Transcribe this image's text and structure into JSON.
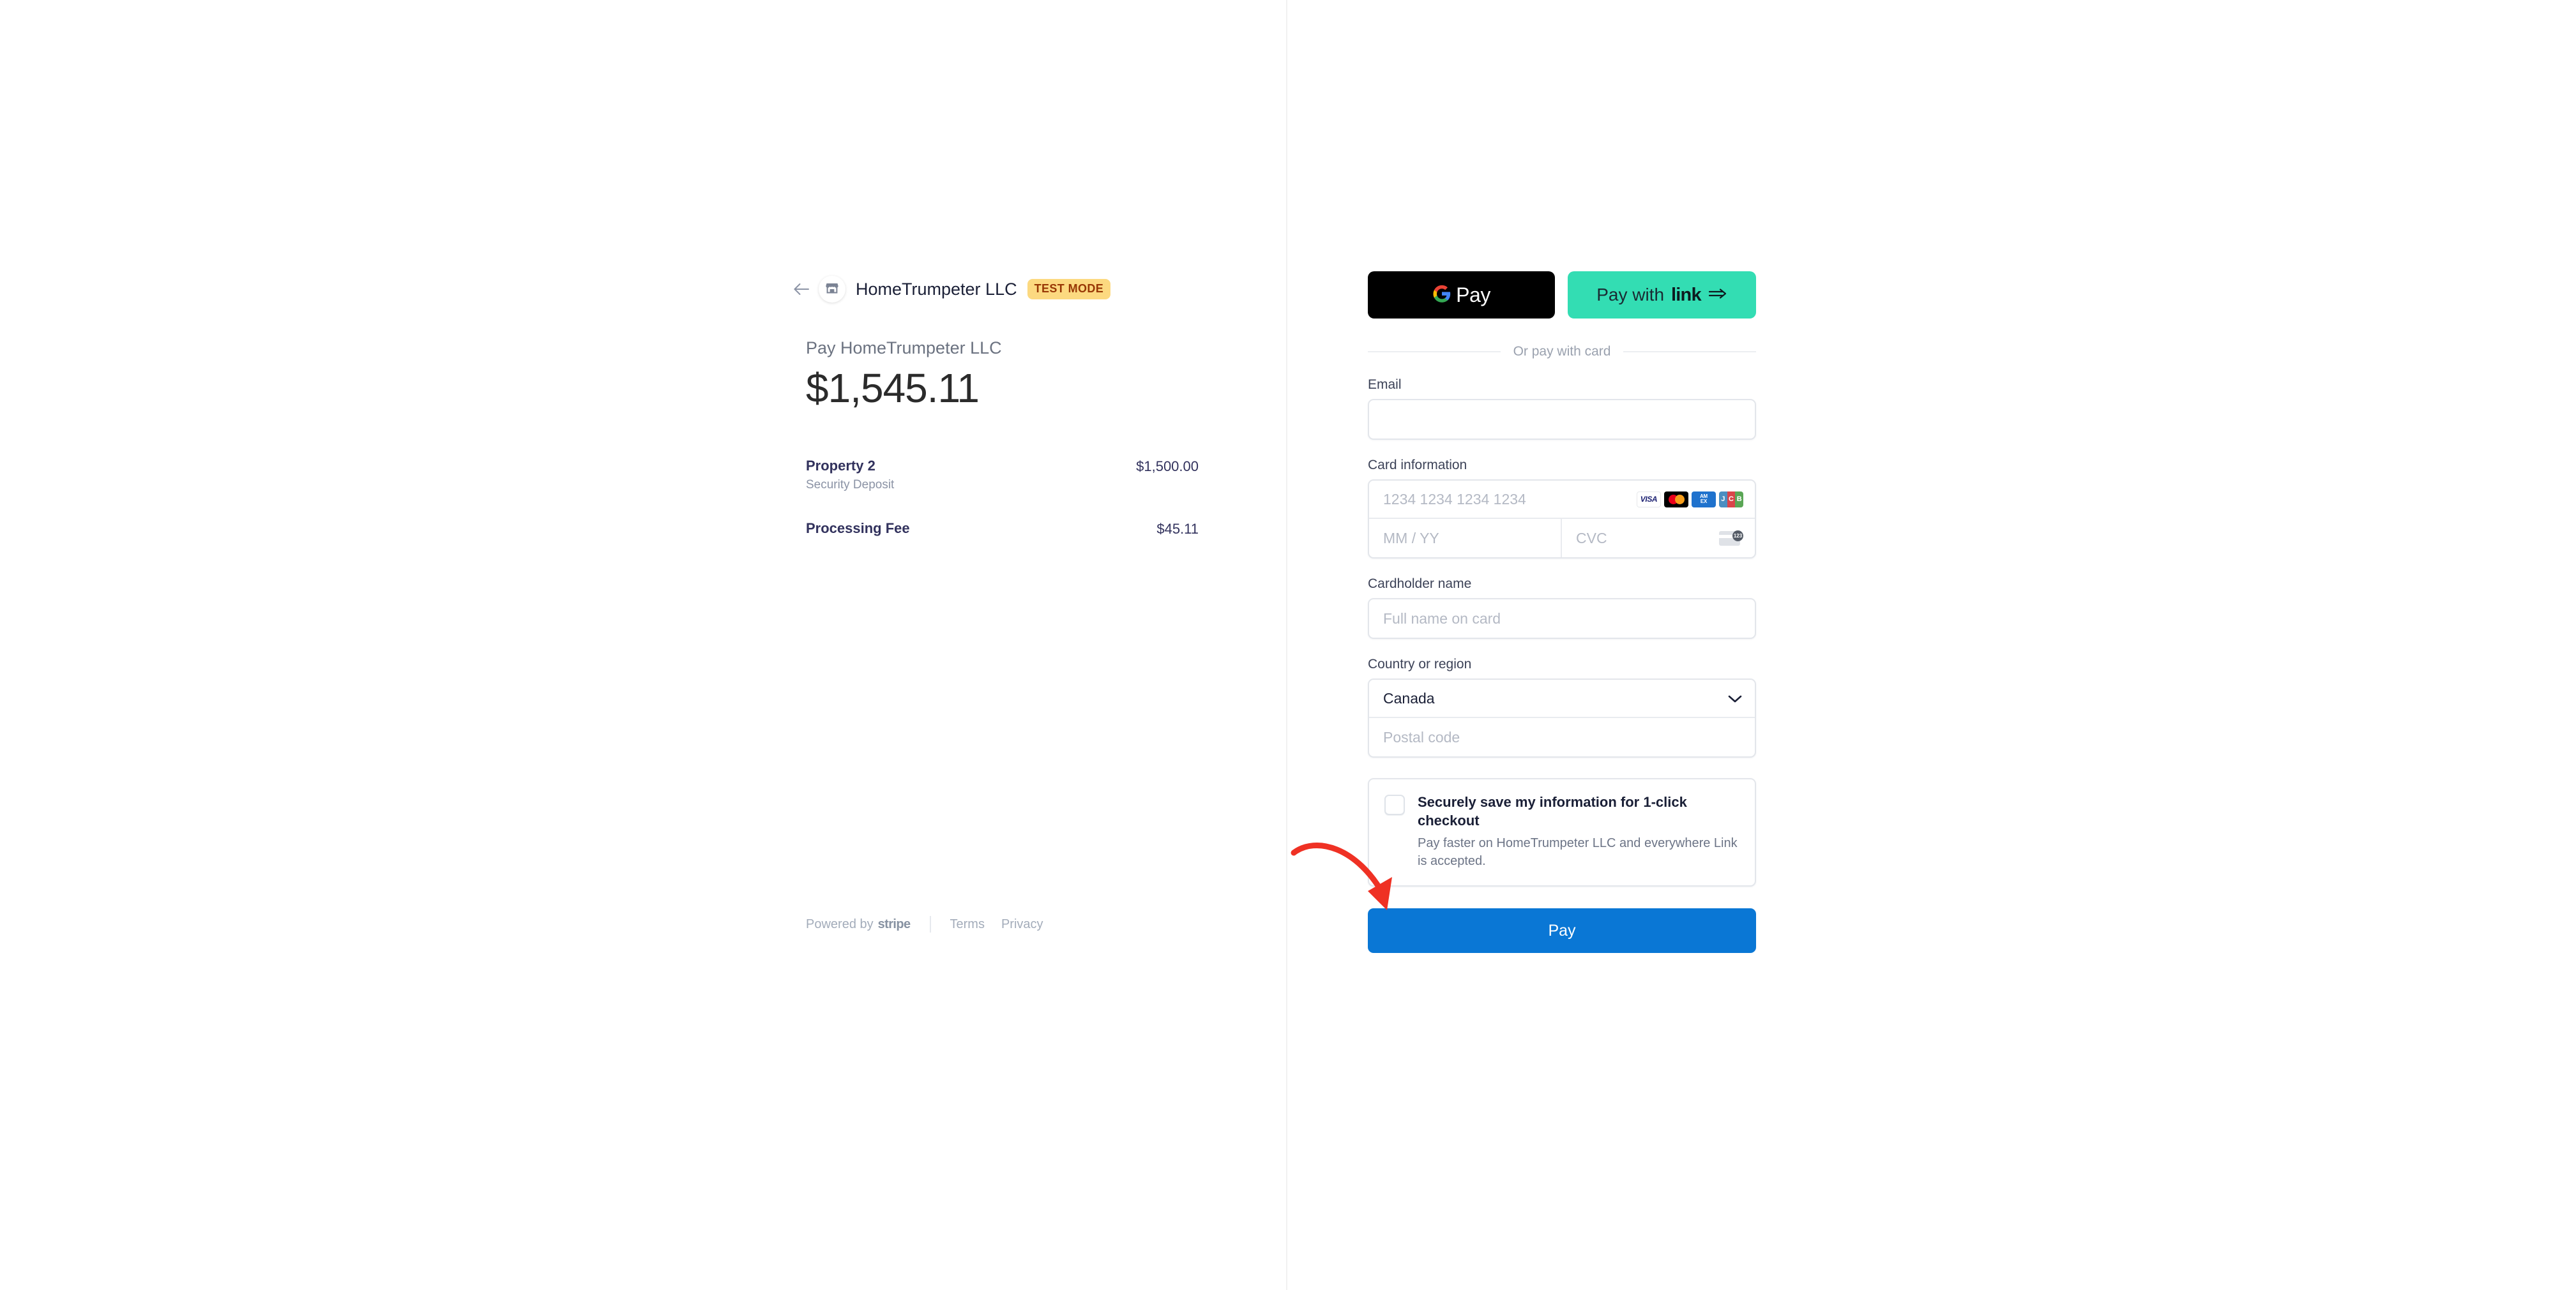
{
  "merchant": {
    "back_icon": "back-arrow-icon",
    "avatar_icon": "storefront-icon",
    "name": "HomeTrumpeter LLC",
    "test_mode_badge": "TEST MODE"
  },
  "summary": {
    "pay_to_label": "Pay HomeTrumpeter LLC",
    "amount": "$1,545.11",
    "line_items": [
      {
        "title": "Property 2",
        "subtitle": "Security Deposit",
        "amount": "$1,500.00"
      },
      {
        "title": "Processing Fee",
        "subtitle": "",
        "amount": "$45.11"
      }
    ]
  },
  "footer": {
    "powered_by": "Powered by",
    "stripe": "stripe",
    "terms": "Terms",
    "privacy": "Privacy"
  },
  "wallets": {
    "google_pay_label": "Pay",
    "link_prefix": "Pay with",
    "link_logo": "link",
    "link_arrow_icon": "double-arrow-icon"
  },
  "divider": {
    "text": "Or pay with card"
  },
  "form": {
    "email": {
      "label": "Email",
      "value": "",
      "placeholder": ""
    },
    "card_information": {
      "label": "Card information",
      "number_placeholder": "1234 1234 1234 1234",
      "number_value": "",
      "expiry_placeholder": "MM / YY",
      "expiry_value": "",
      "cvc_placeholder": "CVC",
      "cvc_value": "",
      "brands": [
        {
          "name": "visa-icon",
          "text": "VISA"
        },
        {
          "name": "mastercard-icon",
          "text": ""
        },
        {
          "name": "amex-icon",
          "text": "AM EX"
        },
        {
          "name": "jcb-icon",
          "text": "JCB"
        }
      ],
      "cvc_hint_icon": "cvc-card-icon",
      "cvc_hint_digits": "123"
    },
    "cardholder_name": {
      "label": "Cardholder name",
      "placeholder": "Full name on card",
      "value": ""
    },
    "country_or_region": {
      "label": "Country or region",
      "selected": "Canada",
      "chevron_icon": "chevron-down-icon",
      "postal_placeholder": "Postal code",
      "postal_value": ""
    },
    "save_info": {
      "checked": false,
      "title": "Securely save my information for 1-click checkout",
      "description": "Pay faster on HomeTrumpeter LLC and everywhere Link is accepted."
    },
    "submit": {
      "label": "Pay"
    }
  },
  "annotation": {
    "arrow_color": "#ef3124",
    "target": "pay-button"
  },
  "colors": {
    "accent_blue": "#0a77d5",
    "link_green": "#33ddb3",
    "test_badge_bg": "#fcd980",
    "test_badge_text": "#983705",
    "gpay_bg": "#000000"
  }
}
